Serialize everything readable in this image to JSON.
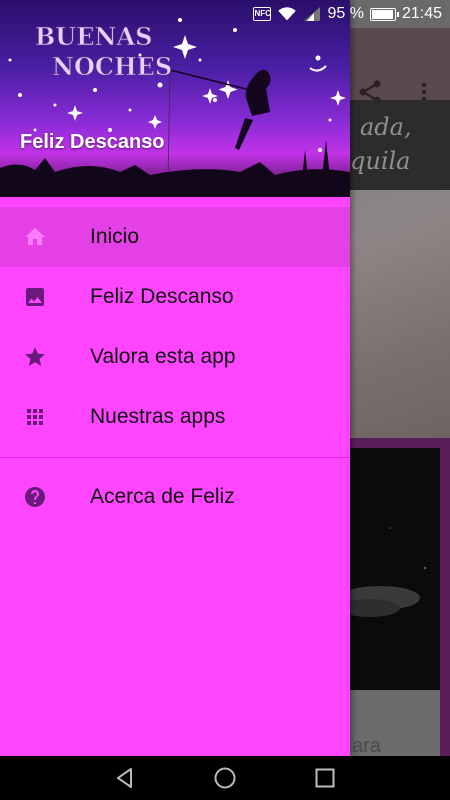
{
  "status_bar": {
    "nfc": "NFC",
    "battery": "95 %",
    "time": "21:45",
    "icons": [
      "nfc-icon",
      "wifi-icon",
      "signal-icon",
      "battery-icon"
    ]
  },
  "background": {
    "banner_text_line1": "ada,",
    "banner_text_line2": "quila",
    "card_text": "ara"
  },
  "drawer": {
    "header_logo_line1": "BUENAS",
    "header_logo_line2": "NOCHES",
    "header_title": "Feliz Descanso",
    "items": [
      {
        "label": "Inicio",
        "icon": "home-icon",
        "active": true
      },
      {
        "label": "Feliz Descanso",
        "icon": "image-icon",
        "active": false
      },
      {
        "label": "Valora esta app",
        "icon": "star-icon",
        "active": false
      },
      {
        "label": "Nuestras apps",
        "icon": "apps-grid-icon",
        "active": false
      },
      {
        "label": "Acerca de Feliz",
        "icon": "help-icon",
        "active": false
      }
    ]
  },
  "colors": {
    "drawer_bg": "#ff45ff",
    "active_item_bg": "#e540e5",
    "icon_color": "#6a1a7a",
    "active_icon_color": "#ff7aff"
  },
  "nav_bar": {
    "icons": [
      "back-icon",
      "home-circle-icon",
      "recents-icon"
    ]
  }
}
